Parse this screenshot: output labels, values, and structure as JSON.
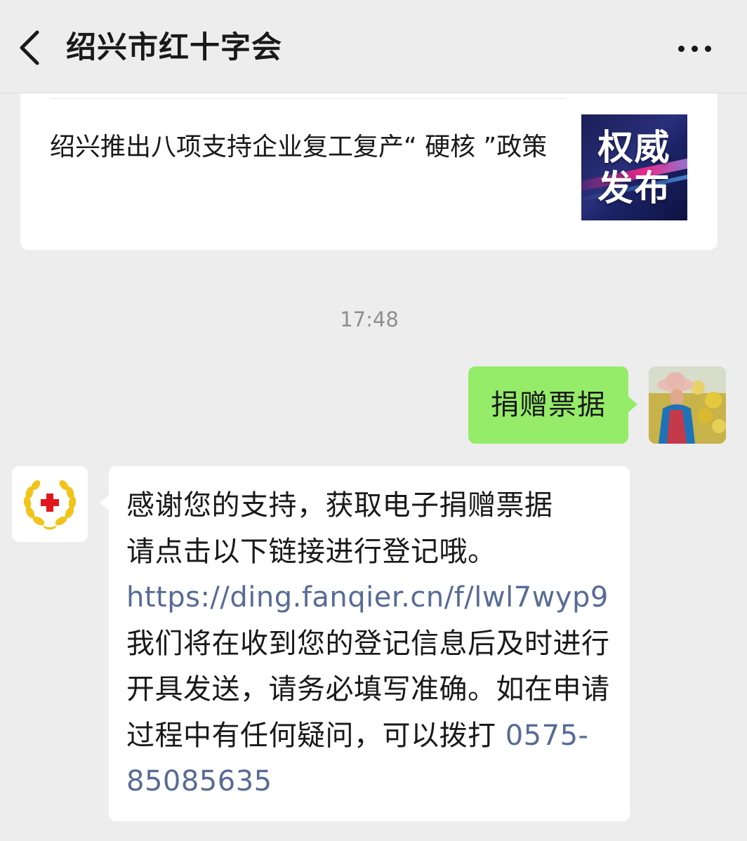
{
  "header": {
    "title": "绍兴市红十字会",
    "back_icon": "chevron-left-icon",
    "more_icon": "more-horizontal-icon"
  },
  "article": {
    "title": "绍兴推出八项支持企业复工复产“ 硬核 ”政策",
    "thumbnail_text": "权威发布"
  },
  "chat": {
    "timestamp": "17:48",
    "sent_message": "捐赠票据",
    "received": {
      "line1": "感谢您的支持，获取电子捐赠票据",
      "line2": "请点击以下链接进行登记哦。",
      "link": "https://ding.fanqier.cn/f/lwl7wyp9",
      "line3": "我们将在收到您的登记信息后及时进行开具发送，请务必填写准确。如在申请过程中有任何疑问，可以拨打 ",
      "phone": "0575-85085635"
    }
  },
  "colors": {
    "background": "#ededed",
    "sent_bubble": "#95ec69",
    "link": "#576b95",
    "red_cross": "#e3161f",
    "laurel_gold": "#f0c419"
  }
}
